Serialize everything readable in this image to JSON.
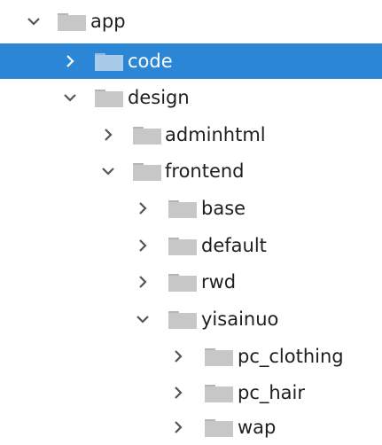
{
  "tree": {
    "nodes": [
      {
        "label": "app",
        "expanded": true,
        "selected": false
      },
      {
        "label": "code",
        "expanded": false,
        "selected": true
      },
      {
        "label": "design",
        "expanded": true,
        "selected": false
      },
      {
        "label": "adminhtml",
        "expanded": false,
        "selected": false
      },
      {
        "label": "frontend",
        "expanded": true,
        "selected": false
      },
      {
        "label": "base",
        "expanded": false,
        "selected": false
      },
      {
        "label": "default",
        "expanded": false,
        "selected": false
      },
      {
        "label": "rwd",
        "expanded": false,
        "selected": false
      },
      {
        "label": "yisainuo",
        "expanded": true,
        "selected": false
      },
      {
        "label": "pc_clothing",
        "expanded": false,
        "selected": false
      },
      {
        "label": "pc_hair",
        "expanded": false,
        "selected": false
      },
      {
        "label": "wap",
        "expanded": false,
        "selected": false
      }
    ]
  },
  "colors": {
    "selection": "#2c86d6",
    "folder": "#c7c7c7",
    "folder_tab": "#b5b5b5",
    "folder_selected": "#a9cbea",
    "chevron": "#555555",
    "text": "#1e1e1e",
    "text_selected": "#ffffff"
  }
}
